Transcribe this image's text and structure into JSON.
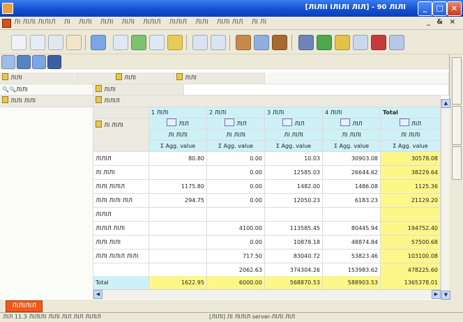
{
  "window": {
    "title": "[ЛІЛІІ ІЛІЛІ ЛІЛ] - 90 ЛІЛІ",
    "min_label": "_",
    "max_label": "□",
    "close_label": "×"
  },
  "menu": {
    "items": [
      "ЛІ ЛІЛІ ЛІЛІЛ",
      "ЛІ",
      "ЛІЛІ",
      "ЛІЛІ",
      "ЛІЛІ",
      "ЛІЛІЛ",
      "ЛІЛІЛ",
      "ЛІЛІ",
      "ЛІЛІ ЛІЛ",
      "ЛІ ЛІ"
    ],
    "mdi_controls": "_ & ×"
  },
  "pivot": {
    "field_bar": [
      "ЛІЛІ",
      "ЛІЛІ",
      "ЛІЛІ"
    ],
    "filter_label": "ЛІЛІ",
    "row_field": "ЛІЛІ ЛІЛІ",
    "col_field_label": "ЛІЛІ",
    "col_field_value": "ЛІЛІЛ",
    "col_headers": [
      "1 ЛІЛІ",
      "2 ЛІЛІ",
      "3 ЛІЛІ",
      "4 ЛІЛІ",
      "Total"
    ],
    "row_field_header": "ЛІ ЛІЛІ",
    "checkbox_labels": [
      "ЛІЛ",
      "ЛІЛ",
      "ЛІЛ",
      "ЛІЛ",
      "ЛІЛ"
    ],
    "sum_labels": [
      "ЛІ ЛІЛІ",
      "ЛІ ЛІЛІ",
      "ЛІ ЛІЛІ",
      "ЛІ ЛІЛІ",
      "ЛІ ЛІЛІ"
    ],
    "measure_labels": [
      "Σ Agg. value",
      "Σ Agg. value",
      "Σ Agg. value",
      "Σ Agg. value",
      "Σ Agg. value"
    ],
    "rows": [
      {
        "label": "ЛІЛІЛ",
        "values": [
          "80.80",
          "0.00",
          "10.03",
          "30903.08",
          "30578.08"
        ]
      },
      {
        "label": "ЛІ ЛІЛІ",
        "values": [
          "",
          "0.00",
          "12585.03",
          "26644.62",
          "38229.64"
        ]
      },
      {
        "label": "ЛІЛІ ЛІЛІЛ",
        "values": [
          "1175.80",
          "0.00",
          "1482.00",
          "1486.08",
          "1125.36"
        ]
      },
      {
        "label": "ЛІЛІ ЛІЛІ ЛІЛ",
        "values": [
          "294.75",
          "0.00",
          "12050.23",
          "6183.23",
          "21129.20"
        ]
      },
      {
        "label": "ЛІЛІЛ",
        "values": [
          "",
          "",
          "",
          "",
          ""
        ]
      },
      {
        "label": "ЛІЛІЛ ЛІЛІ",
        "values": [
          "",
          "4100.00",
          "113585.45",
          "80445.94",
          "194752.40"
        ]
      },
      {
        "label": "ЛІЛІ ЛІЛІ",
        "values": [
          "",
          "0.00",
          "10878.18",
          "48874.84",
          "57500.68"
        ]
      },
      {
        "label": "ЛІЛІ ЛІЛІЛ ЛІЛІ",
        "values": [
          "",
          "717.50",
          "83040.72",
          "53823.46",
          "103100.08"
        ]
      },
      {
        "label": "",
        "values": [
          "",
          "2062.63",
          "374304.26",
          "153983.62",
          "478225.60"
        ]
      }
    ],
    "total_row": {
      "label": "Total",
      "values": [
        "1622.95",
        "6000.00",
        "568870.53",
        "588903.53",
        "1365378.01"
      ]
    }
  },
  "sheet_tab": "ЛІЛІЛІЛ",
  "status": {
    "left": "ЛІЛ 11.3 ЛІЛІЛІ ЛІЛІ ЛІЛ ЛІЛ ЛІЛІЛ",
    "right": "[ЛІЛІ] ЛІ ЛІЛІЛ server-ЛІЛІ ЛІЛ"
  },
  "colors": {
    "titlebar": "#1450d2",
    "total_fill": "#fdf78a",
    "header_fill": "#cdf1f7",
    "sheet_tab": "#f05a1a"
  }
}
